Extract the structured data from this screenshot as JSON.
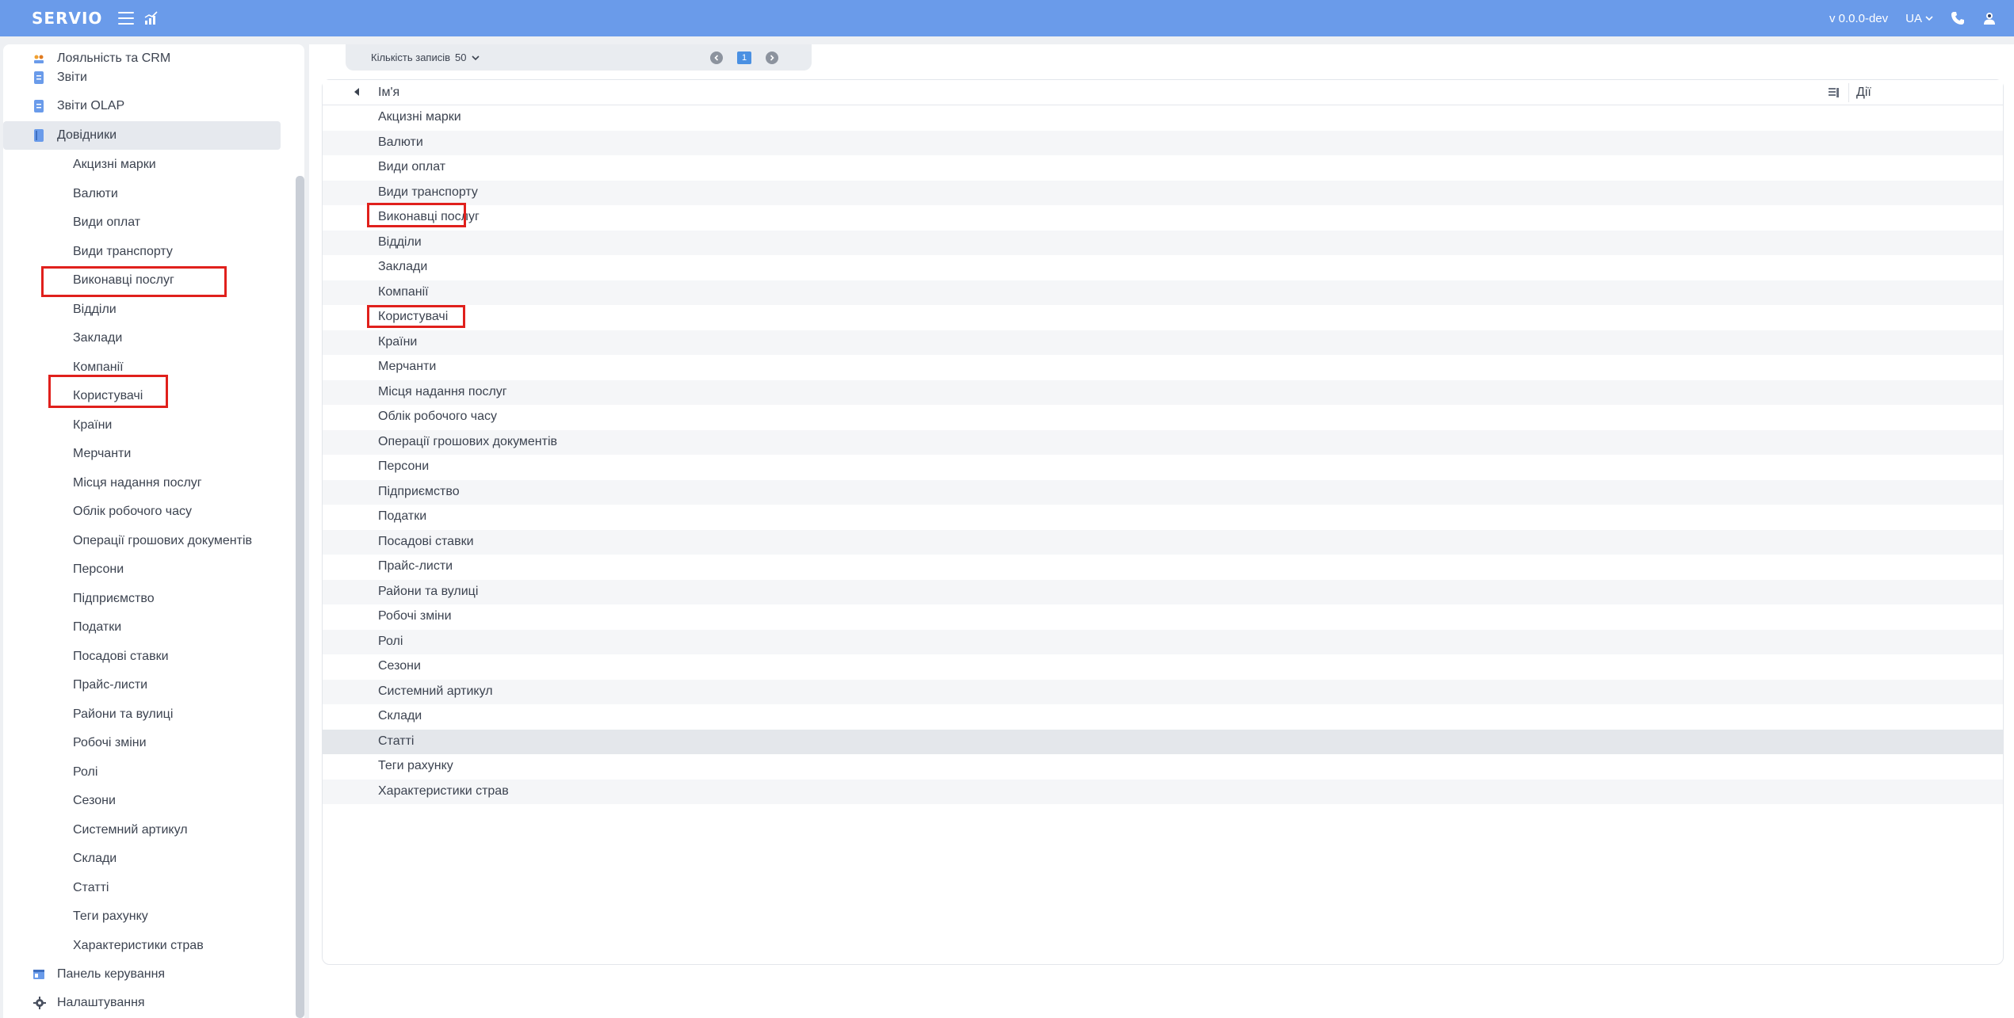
{
  "header": {
    "logo": "SERVIO",
    "version": "v 0.0.0-dev",
    "language": "UA"
  },
  "sidebar": {
    "top_items": [
      {
        "label": "Лояльність та CRM",
        "icon": "people-icon"
      },
      {
        "label": "Звіти",
        "icon": "document-icon"
      },
      {
        "label": "Звіти OLAP",
        "icon": "document-icon"
      },
      {
        "label": "Довідники",
        "icon": "book-icon",
        "active": true
      }
    ],
    "sub_items": [
      "Акцизні марки",
      "Валюти",
      "Види оплат",
      "Види транспорту",
      "Виконавці послуг",
      "Відділи",
      "Заклади",
      "Компанії",
      "Користувачі",
      "Країни",
      "Мерчанти",
      "Місця надання послуг",
      "Облік робочого часу",
      "Операції грошових документів",
      "Персони",
      "Підприємство",
      "Податки",
      "Посадові ставки",
      "Прайс-листи",
      "Райони та вулиці",
      "Робочі зміни",
      "Ролі",
      "Сезони",
      "Системний артикул",
      "Склади",
      "Статті",
      "Теги рахунку",
      "Характеристики страв"
    ],
    "bottom_items": [
      {
        "label": "Панель керування",
        "icon": "dashboard-icon"
      },
      {
        "label": "Налаштування",
        "icon": "gear-icon"
      }
    ]
  },
  "pager": {
    "label": "Кількість записів",
    "value": "50",
    "current_page": "1"
  },
  "grid": {
    "col_name": "Ім'я",
    "col_actions": "Дії",
    "rows": [
      "Акцизні марки",
      "Валюти",
      "Види оплат",
      "Види транспорту",
      "Виконавці послуг",
      "Відділи",
      "Заклади",
      "Компанії",
      "Користувачі",
      "Країни",
      "Мерчанти",
      "Місця надання послуг",
      "Облік робочого часу",
      "Операції грошових документів",
      "Персони",
      "Підприємство",
      "Податки",
      "Посадові ставки",
      "Прайс-листи",
      "Райони та вулиці",
      "Робочі зміни",
      "Ролі",
      "Сезони",
      "Системний артикул",
      "Склади",
      "Статті",
      "Теги рахунку",
      "Характеристики страв"
    ],
    "selected_row": "Статті"
  },
  "colors": {
    "header": "#6a9bea",
    "highlight": "#e0201c",
    "page_active": "#4a90e2"
  }
}
